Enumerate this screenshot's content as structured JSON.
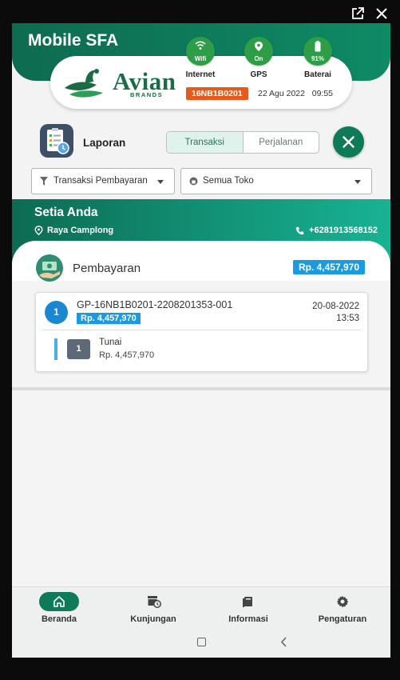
{
  "app": {
    "title": "Mobile SFA"
  },
  "brand": {
    "name": "Avian",
    "sub": "BRANDS"
  },
  "status": {
    "internet": {
      "label": "Internet",
      "value": "Wifi",
      "icon": "wifi-icon"
    },
    "gps": {
      "label": "GPS",
      "value": "On",
      "icon": "location-pin-icon"
    },
    "battery": {
      "label": "Baterai",
      "value": "91%",
      "icon": "battery-icon"
    },
    "device_id": "16NB1B0201",
    "date": "22 Agu 2022",
    "time": "09:55"
  },
  "report": {
    "title": "Laporan",
    "tabs": [
      {
        "label": "Transaksi",
        "active": true
      },
      {
        "label": "Perjalanan",
        "active": false
      }
    ]
  },
  "filters": {
    "type": {
      "value": "Transaksi Pembayaran",
      "icon": "filter-icon"
    },
    "store": {
      "value": "Semua Toko",
      "icon": "store-icon"
    }
  },
  "store": {
    "name": "Setia Anda",
    "address": "Raya Camplong",
    "phone": "+6281913568152"
  },
  "payment": {
    "title": "Pembayaran",
    "total": "Rp. 4,457,970",
    "transactions": [
      {
        "number": "1",
        "code": "GP-16NB1B0201-2208201353-001",
        "amount": "Rp. 4,457,970",
        "date": "20-08-2022",
        "time": "13:53",
        "methods": [
          {
            "number": "1",
            "name": "Tunai",
            "amount": "Rp. 4,457,970"
          }
        ]
      }
    ]
  },
  "nav": [
    {
      "label": "Beranda",
      "icon": "home-icon",
      "active": true
    },
    {
      "label": "Kunjungan",
      "icon": "store-clock-icon",
      "active": false
    },
    {
      "label": "Informasi",
      "icon": "book-icon",
      "active": false
    },
    {
      "label": "Pengaturan",
      "icon": "gear-icon",
      "active": false
    }
  ],
  "colors": {
    "primary": "#0e7a57",
    "accent_blue": "#1a9ae0",
    "badge_orange": "#e35b1d",
    "status_green": "#2e9d47"
  }
}
